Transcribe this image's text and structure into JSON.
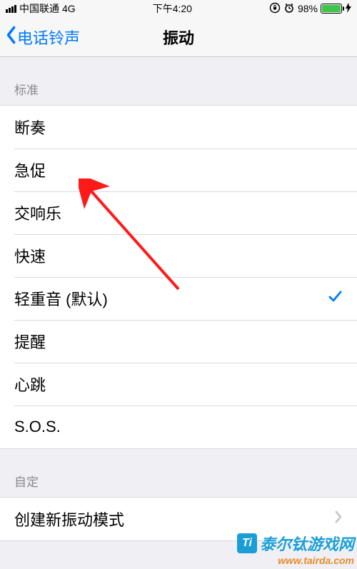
{
  "status": {
    "carrier": "中国联通",
    "network": "4G",
    "time": "下午4:20",
    "battery_pct": "98%"
  },
  "nav": {
    "back_label": "电话铃声",
    "title": "振动"
  },
  "sections": {
    "standard_header": "标准",
    "custom_header": "自定"
  },
  "patterns": {
    "p0": "断奏",
    "p1": "急促",
    "p2": "交响乐",
    "p3": "快速",
    "p4": "轻重音 (默认)",
    "p5": "提醒",
    "p6": "心跳",
    "p7": "S.O.S."
  },
  "custom": {
    "create_new": "创建新振动模式"
  },
  "watermark": {
    "name": "泰尔钛游戏网",
    "url": "www.tairda.com"
  }
}
